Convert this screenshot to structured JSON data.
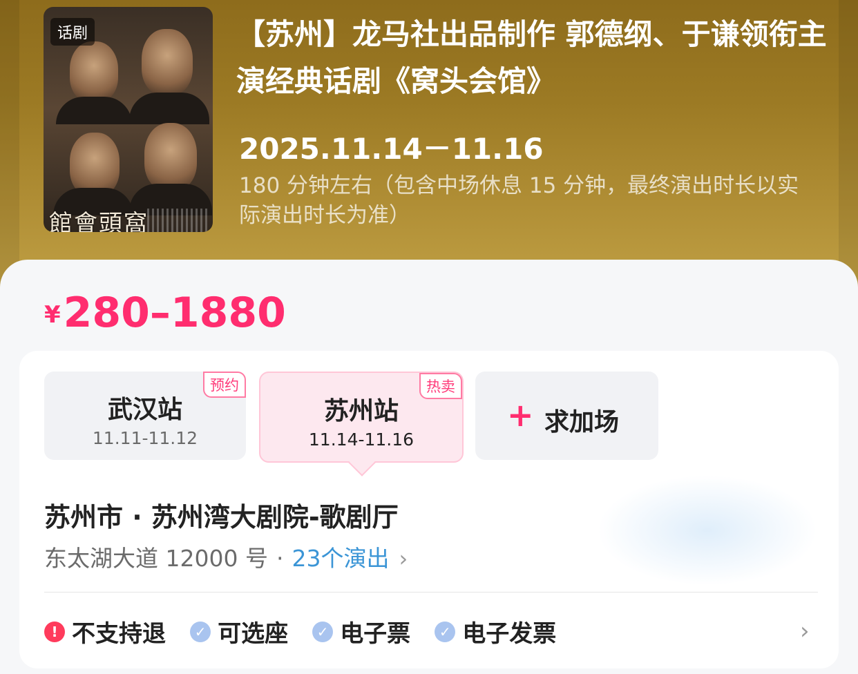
{
  "event": {
    "category_tag": "话剧",
    "poster_caption": "館會頭窩",
    "title": "【苏州】龙马社出品制作 郭德纲、于谦领衔主演经典话剧《窝头会馆》",
    "date_range": "2025.11.14－11.16",
    "duration_note": "180 分钟左右（包含中场休息 15 分钟，最终演出时长以实际演出时长为准）"
  },
  "price": {
    "currency_symbol": "¥",
    "range": "280–1880"
  },
  "stations": [
    {
      "name": "武汉站",
      "dates": "11.11-11.12",
      "badge": "预约"
    },
    {
      "name": "苏州站",
      "dates": "11.14-11.16",
      "badge": "热卖"
    }
  ],
  "add_show": {
    "icon": "plus-icon",
    "label": "求加场"
  },
  "venue": {
    "name": "苏州市 · 苏州湾大剧院-歌剧厅",
    "address": "东太湖大道 12000 号",
    "separator": "·",
    "show_count": "23个演出",
    "chevron": "›"
  },
  "policies": [
    {
      "icon": "exclamation-icon",
      "glyph": "!",
      "label": "不支持退"
    },
    {
      "icon": "check-icon",
      "glyph": "✓",
      "label": "可选座"
    },
    {
      "icon": "check-icon",
      "glyph": "✓",
      "label": "电子票"
    },
    {
      "icon": "check-icon",
      "glyph": "✓",
      "label": "电子发票"
    }
  ],
  "policies_chevron": "›",
  "colors": {
    "accent": "#ff2d6f",
    "header_gold": "#a8862c",
    "link_blue": "#3b95d6",
    "warn_red": "#ff3b5c",
    "check_blue": "#a9c4ef"
  }
}
